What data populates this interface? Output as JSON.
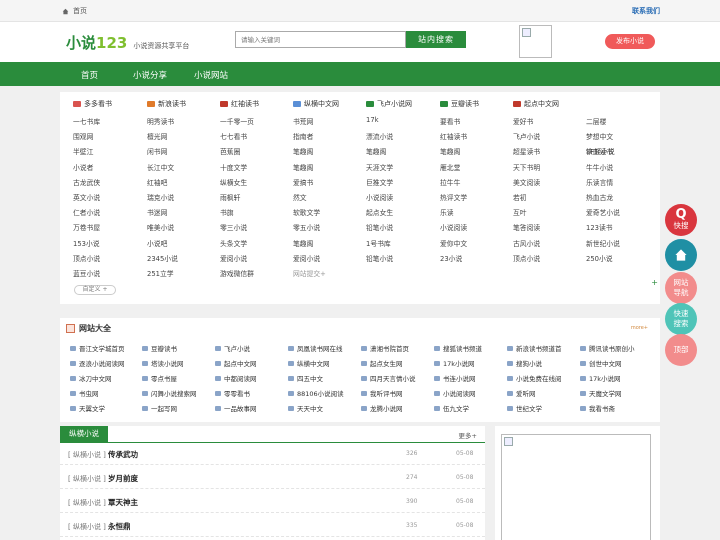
{
  "topbar": {
    "home_label": "首页",
    "contact_label": "联系我们"
  },
  "header": {
    "logo_main": "小说",
    "logo_num": "123",
    "logo_sub": "小说资源共享平台",
    "search_placeholder": "请输入关键词",
    "search_button": "站内搜索",
    "publish_button": "发布小说"
  },
  "nav": [
    "首页",
    "小说分享",
    "小说网站"
  ],
  "site_columns": [
    {
      "header": "多多看书",
      "color": "#d9534f",
      "items": [
        "一七书库",
        "围观网",
        "半壁江",
        "小说者",
        "古龙武侠",
        "英文小说",
        "仁者小说",
        "万卷书屋",
        "153小说",
        "顶点小说",
        "蓝豆小说"
      ]
    },
    {
      "header": "新浪读书",
      "color": "#e07a2a",
      "items": [
        "明秀读书",
        "檀光网",
        "闲书网",
        "长江中文",
        "红袖吧",
        "瑞克小说",
        "书迷网",
        "唯美小说",
        "小说吧",
        "2345小说",
        "251立学"
      ]
    },
    {
      "header": "红袖读书",
      "color": "#c0392b",
      "items": [
        "一千零一页",
        "七七看书",
        "芭蕉圈",
        "十度文学",
        "纵横女生",
        "雨枫轩",
        "书旗",
        "零三小说",
        "头条文学",
        "爱阅小说",
        "游戏微信群"
      ]
    },
    {
      "header": "纵横中文网",
      "color": "#5a8fd6",
      "items": [
        "书荒网",
        "指南者",
        "笔趣阁",
        "笔趣阁",
        "爱搞书",
        "然文",
        "软歌文学",
        "零五小说",
        "笔趣阁",
        "爱阅小说",
        "网站提交+"
      ]
    },
    {
      "header": "飞卢小说网",
      "color": "#2a8c3c",
      "items": [
        "17k",
        "漂流小说",
        "笔趣阁",
        "天涯文学",
        "巨推文学",
        "小说阅读",
        "起点女生",
        "铅笔小说",
        "1号书库",
        "铅笔小说"
      ]
    },
    {
      "header": "豆瓣读书",
      "color": "#2a8c3c",
      "items": [
        "要看书",
        "红袖读书",
        "笔趣阁",
        "雁北堂",
        "拉牛牛",
        "热评文学",
        "乐读",
        "小说阅读",
        "爱你中文",
        "23小说"
      ]
    },
    {
      "header": "起点中文网",
      "color": "#c0392b",
      "items": [
        "爱好书",
        "飞卢小说",
        "超星读书",
        "天下书明",
        "美文阅读",
        "若初",
        "互叶",
        "笔答阅读",
        "古风小说",
        "顶点小说"
      ]
    },
    {
      "header": "",
      "color": "",
      "items": [
        "二层楼",
        "梦想中文",
        "SF轻小说",
        "牛牛小说",
        "乐读言情",
        "热血古龙",
        "爱奇艺小说",
        "123读书",
        "新世纪小说",
        "250小说"
      ]
    },
    {
      "header": "",
      "color": "",
      "items": [
        "",
        "",
        "铁血读书",
        "",
        "",
        "",
        "",
        "",
        "",
        "",
        ""
      ]
    }
  ],
  "custom_button": "自定义 +",
  "directory": {
    "title": "网站大全",
    "more": "more+",
    "rows": [
      [
        "晋江文学城首页",
        "豆瓣读书",
        "飞卢小说",
        "凤凰读书网在线",
        "潇湘书院首页",
        "搜狐读书频道",
        "新浪读书频道首",
        "腾讯读书原创小"
      ],
      [
        "逐浪小说阅读网",
        "塔读小说网",
        "起点中文网",
        "纵横中文网",
        "起点女生网",
        "17k小说网",
        "搜狗小说",
        "创世中文网"
      ],
      [
        "冰刀中文网",
        "零点书屋",
        "中都阅读网",
        "四五中文",
        "四月天言情小说",
        "书连小说网",
        "小说免费在线阅",
        "17k小说网"
      ],
      [
        "书虫网",
        "闪舞小说搜索网",
        "零零看书",
        "88106小说阅读",
        "我听评书网",
        "小说阅读网",
        "爱听网",
        "天魔文学网"
      ],
      [
        "天翼文学",
        "一起写网",
        "一品故事网",
        "天天中文",
        "龙腾小说网",
        "伍九文学",
        "世纪文学",
        "我看书斋"
      ]
    ]
  },
  "novels": {
    "tab": "纵横小说",
    "more": "更多+",
    "rows": [
      {
        "cat": "[ 纵横小说 ]",
        "name": "传承武功",
        "num": "326",
        "date": "05-08"
      },
      {
        "cat": "[ 纵横小说 ]",
        "name": "岁月前度",
        "num": "274",
        "date": "05-08"
      },
      {
        "cat": "[ 纵横小说 ]",
        "name": "覃天神主",
        "num": "390",
        "date": "05-08"
      },
      {
        "cat": "[ 纵横小说 ]",
        "name": "永恒鼎",
        "num": "335",
        "date": "05-08"
      }
    ]
  },
  "float_buttons": [
    {
      "label": "快搜",
      "color": "#d9363e"
    },
    {
      "label": "",
      "color": "#1f8fa4"
    },
    {
      "label": "网站导航",
      "color": "#f28c8c"
    },
    {
      "label": "快速搜索",
      "color": "#4fc4b8"
    },
    {
      "label": "顶部",
      "color": "#f28c8c"
    }
  ]
}
